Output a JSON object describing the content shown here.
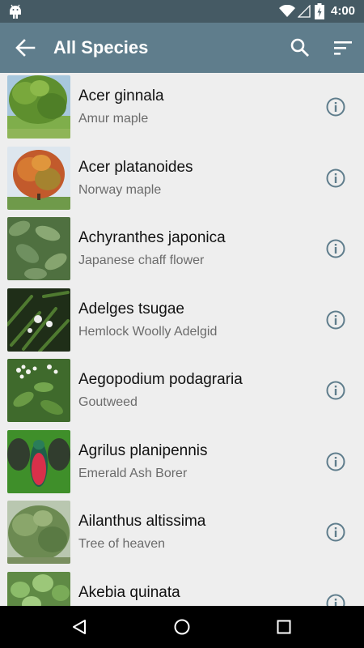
{
  "status_bar": {
    "time": "4:00",
    "icons": [
      "android-icon",
      "wifi-icon",
      "signal-icon",
      "battery-icon"
    ]
  },
  "app_bar": {
    "title": "All Species",
    "background": "#5f7d8c",
    "icons": [
      "back-arrow-icon",
      "search-icon",
      "sort-icon"
    ]
  },
  "species": [
    {
      "scientific": "Acer ginnala",
      "common": "Amur maple",
      "thumb": "tree-green"
    },
    {
      "scientific": "Acer platanoides",
      "common": "Norway maple",
      "thumb": "tree-autumn"
    },
    {
      "scientific": "Achyranthes japonica",
      "common": "Japanese chaff flower",
      "thumb": "leaves-dense"
    },
    {
      "scientific": "Adelges tsugae",
      "common": "Hemlock Woolly Adelgid",
      "thumb": "hemlock-needles"
    },
    {
      "scientific": "Aegopodium podagraria",
      "common": "Goutweed",
      "thumb": "white-flowers"
    },
    {
      "scientific": "Agrilus planipennis",
      "common": "Emerald Ash Borer",
      "thumb": "beetle"
    },
    {
      "scientific": "Ailanthus altissima",
      "common": "Tree of heaven",
      "thumb": "shrub-foliage"
    },
    {
      "scientific": "Akebia quinata",
      "common": "",
      "thumb": "round-leaves"
    }
  ],
  "nav_bar": {
    "icons": [
      "back-triangle-icon",
      "home-circle-icon",
      "recents-square-icon"
    ]
  }
}
